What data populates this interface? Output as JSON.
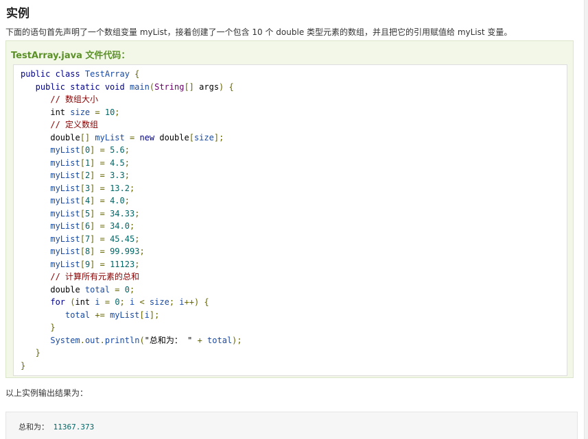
{
  "section": {
    "title": "实例",
    "intro": "下面的语句首先声明了一个数组变量 myList，接着创建了一个包含 10 个 double 类型元素的数组，并且把它的引用赋值给 myList 变量。"
  },
  "example": {
    "title": "TestArray.java 文件代码：",
    "code_lines": [
      [
        {
          "t": "public class ",
          "c": "kw"
        },
        {
          "t": "TestArray",
          "c": "var"
        },
        {
          "t": " {",
          "c": "pun"
        }
      ],
      [
        {
          "t": "   public static void ",
          "c": "kw"
        },
        {
          "t": "main",
          "c": "var"
        },
        {
          "t": "(",
          "c": "pun"
        },
        {
          "t": "String",
          "c": "typ"
        },
        {
          "t": "[] ",
          "c": "pun"
        },
        {
          "t": "args",
          "c": "pln"
        },
        {
          "t": ") {",
          "c": "pun"
        }
      ],
      [
        {
          "t": "      // 数组大小",
          "c": "com"
        }
      ],
      [
        {
          "t": "      int ",
          "c": "pln"
        },
        {
          "t": "size",
          "c": "var"
        },
        {
          "t": " = ",
          "c": "pun"
        },
        {
          "t": "10",
          "c": "lit"
        },
        {
          "t": ";",
          "c": "pun"
        }
      ],
      [
        {
          "t": "      // 定义数组",
          "c": "com"
        }
      ],
      [
        {
          "t": "      double",
          "c": "pln"
        },
        {
          "t": "[] ",
          "c": "pun"
        },
        {
          "t": "myList",
          "c": "var"
        },
        {
          "t": " = ",
          "c": "pun"
        },
        {
          "t": "new ",
          "c": "kw"
        },
        {
          "t": "double",
          "c": "pln"
        },
        {
          "t": "[",
          "c": "pun"
        },
        {
          "t": "size",
          "c": "var"
        },
        {
          "t": "];",
          "c": "pun"
        }
      ],
      [
        {
          "t": "      myList",
          "c": "var"
        },
        {
          "t": "[",
          "c": "pun"
        },
        {
          "t": "0",
          "c": "lit"
        },
        {
          "t": "] = ",
          "c": "pun"
        },
        {
          "t": "5.6",
          "c": "lit"
        },
        {
          "t": ";",
          "c": "pun"
        }
      ],
      [
        {
          "t": "      myList",
          "c": "var"
        },
        {
          "t": "[",
          "c": "pun"
        },
        {
          "t": "1",
          "c": "lit"
        },
        {
          "t": "] = ",
          "c": "pun"
        },
        {
          "t": "4.5",
          "c": "lit"
        },
        {
          "t": ";",
          "c": "pun"
        }
      ],
      [
        {
          "t": "      myList",
          "c": "var"
        },
        {
          "t": "[",
          "c": "pun"
        },
        {
          "t": "2",
          "c": "lit"
        },
        {
          "t": "] = ",
          "c": "pun"
        },
        {
          "t": "3.3",
          "c": "lit"
        },
        {
          "t": ";",
          "c": "pun"
        }
      ],
      [
        {
          "t": "      myList",
          "c": "var"
        },
        {
          "t": "[",
          "c": "pun"
        },
        {
          "t": "3",
          "c": "lit"
        },
        {
          "t": "] = ",
          "c": "pun"
        },
        {
          "t": "13.2",
          "c": "lit"
        },
        {
          "t": ";",
          "c": "pun"
        }
      ],
      [
        {
          "t": "      myList",
          "c": "var"
        },
        {
          "t": "[",
          "c": "pun"
        },
        {
          "t": "4",
          "c": "lit"
        },
        {
          "t": "] = ",
          "c": "pun"
        },
        {
          "t": "4.0",
          "c": "lit"
        },
        {
          "t": ";",
          "c": "pun"
        }
      ],
      [
        {
          "t": "      myList",
          "c": "var"
        },
        {
          "t": "[",
          "c": "pun"
        },
        {
          "t": "5",
          "c": "lit"
        },
        {
          "t": "] = ",
          "c": "pun"
        },
        {
          "t": "34.33",
          "c": "lit"
        },
        {
          "t": ";",
          "c": "pun"
        }
      ],
      [
        {
          "t": "      myList",
          "c": "var"
        },
        {
          "t": "[",
          "c": "pun"
        },
        {
          "t": "6",
          "c": "lit"
        },
        {
          "t": "] = ",
          "c": "pun"
        },
        {
          "t": "34.0",
          "c": "lit"
        },
        {
          "t": ";",
          "c": "pun"
        }
      ],
      [
        {
          "t": "      myList",
          "c": "var"
        },
        {
          "t": "[",
          "c": "pun"
        },
        {
          "t": "7",
          "c": "lit"
        },
        {
          "t": "] = ",
          "c": "pun"
        },
        {
          "t": "45.45",
          "c": "lit"
        },
        {
          "t": ";",
          "c": "pun"
        }
      ],
      [
        {
          "t": "      myList",
          "c": "var"
        },
        {
          "t": "[",
          "c": "pun"
        },
        {
          "t": "8",
          "c": "lit"
        },
        {
          "t": "] = ",
          "c": "pun"
        },
        {
          "t": "99.993",
          "c": "lit"
        },
        {
          "t": ";",
          "c": "pun"
        }
      ],
      [
        {
          "t": "      myList",
          "c": "var"
        },
        {
          "t": "[",
          "c": "pun"
        },
        {
          "t": "9",
          "c": "lit"
        },
        {
          "t": "] = ",
          "c": "pun"
        },
        {
          "t": "11123",
          "c": "lit"
        },
        {
          "t": ";",
          "c": "pun"
        }
      ],
      [
        {
          "t": "      // 计算所有元素的总和",
          "c": "com"
        }
      ],
      [
        {
          "t": "      double ",
          "c": "pln"
        },
        {
          "t": "total",
          "c": "var"
        },
        {
          "t": " = ",
          "c": "pun"
        },
        {
          "t": "0",
          "c": "lit"
        },
        {
          "t": ";",
          "c": "pun"
        }
      ],
      [
        {
          "t": "      for ",
          "c": "kw"
        },
        {
          "t": "(",
          "c": "pun"
        },
        {
          "t": "int ",
          "c": "pln"
        },
        {
          "t": "i",
          "c": "var"
        },
        {
          "t": " = ",
          "c": "pun"
        },
        {
          "t": "0",
          "c": "lit"
        },
        {
          "t": "; ",
          "c": "pun"
        },
        {
          "t": "i",
          "c": "var"
        },
        {
          "t": " < ",
          "c": "pun"
        },
        {
          "t": "size",
          "c": "var"
        },
        {
          "t": "; ",
          "c": "pun"
        },
        {
          "t": "i",
          "c": "var"
        },
        {
          "t": "++) {",
          "c": "pun"
        }
      ],
      [
        {
          "t": "         total",
          "c": "var"
        },
        {
          "t": " += ",
          "c": "pun"
        },
        {
          "t": "myList",
          "c": "var"
        },
        {
          "t": "[",
          "c": "pun"
        },
        {
          "t": "i",
          "c": "var"
        },
        {
          "t": "];",
          "c": "pun"
        }
      ],
      [
        {
          "t": "      }",
          "c": "pun"
        }
      ],
      [
        {
          "t": "      System",
          "c": "var"
        },
        {
          "t": ".",
          "c": "pun"
        },
        {
          "t": "out",
          "c": "var"
        },
        {
          "t": ".",
          "c": "pun"
        },
        {
          "t": "println",
          "c": "var"
        },
        {
          "t": "(",
          "c": "pun"
        },
        {
          "t": "\"总和为： \"",
          "c": "pln"
        },
        {
          "t": " + ",
          "c": "pun"
        },
        {
          "t": "total",
          "c": "var"
        },
        {
          "t": ");",
          "c": "pun"
        }
      ],
      [
        {
          "t": "   }",
          "c": "pun"
        }
      ],
      [
        {
          "t": "}",
          "c": "pun"
        }
      ]
    ]
  },
  "output": {
    "label": "以上实例输出结果为：",
    "prefix": "总和为： ",
    "value": "11367.373"
  },
  "colors": {
    "example_background": "#f2f7e8",
    "example_title": "#5b9127",
    "keyword": "#000088",
    "literal": "#006666",
    "comment": "#880000"
  }
}
